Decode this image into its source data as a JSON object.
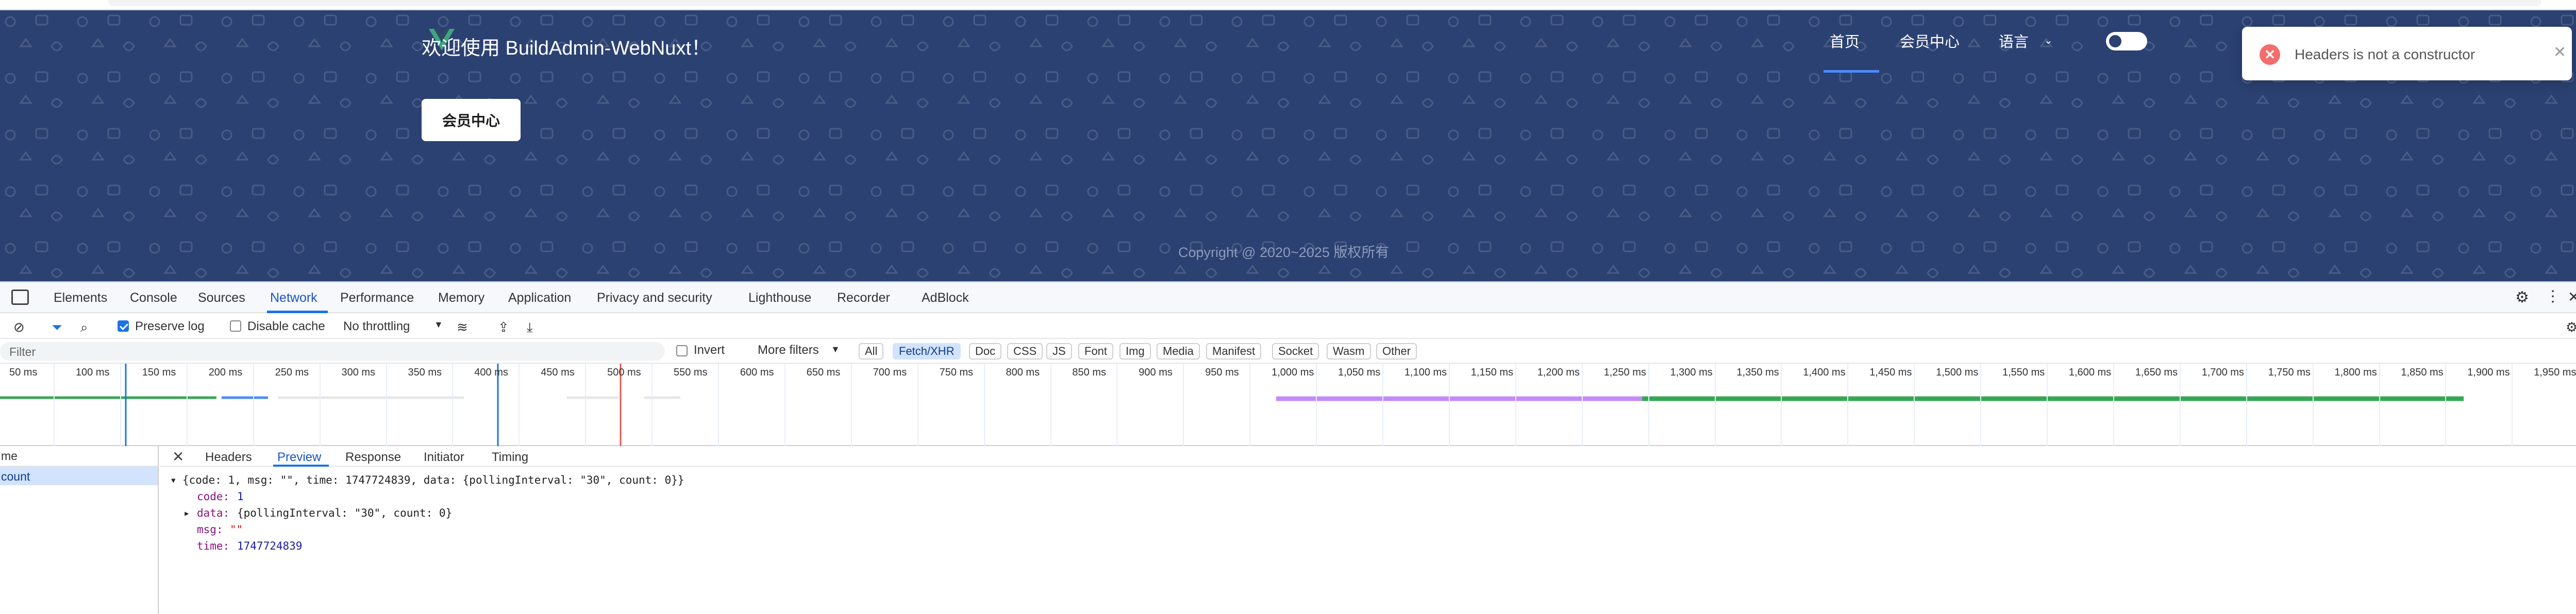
{
  "site": {
    "welcome": "欢迎使用 BuildAdmin-WebNuxt！",
    "member_button": "会员中心",
    "nav": {
      "home": "首页",
      "member": "会员中心",
      "language": "语言"
    },
    "copyright": "Copyright @ 2020~2025 版权所有",
    "colors": {
      "background": "#2b4172",
      "nav_active": "#4a8cff"
    }
  },
  "toast": {
    "message": "Headers is not a constructor",
    "type": "error",
    "icon": "error-circle-icon"
  },
  "devtools": {
    "tabs": [
      "Elements",
      "Console",
      "Sources",
      "Network",
      "Performance",
      "Memory",
      "Application",
      "Privacy and security",
      "Lighthouse",
      "Recorder",
      "AdBlock"
    ],
    "active_tab": "Network",
    "toolbar": {
      "preserve_log": "Preserve log",
      "disable_cache": "Disable cache",
      "throttling": "No throttling"
    },
    "filter": {
      "placeholder": "Filter",
      "invert": "Invert",
      "more_filters": "More filters",
      "types": [
        "All",
        "Fetch/XHR",
        "Doc",
        "CSS",
        "JS",
        "Font",
        "Img",
        "Media",
        "Manifest",
        "Socket",
        "Wasm",
        "Other"
      ],
      "active_type": "Fetch/XHR"
    },
    "timeline_ticks": [
      "50 ms",
      "100 ms",
      "150 ms",
      "200 ms",
      "250 ms",
      "300 ms",
      "350 ms",
      "400 ms",
      "450 ms",
      "500 ms",
      "550 ms",
      "600 ms",
      "650 ms",
      "700 ms",
      "750 ms",
      "800 ms",
      "850 ms",
      "900 ms",
      "950 ms",
      "1,000 ms",
      "1,050 ms",
      "1,100 ms",
      "1,150 ms",
      "1,200 ms",
      "1,250 ms",
      "1,300 ms",
      "1,350 ms",
      "1,400 ms",
      "1,450 ms",
      "1,500 ms",
      "1,550 ms",
      "1,600 ms",
      "1,650 ms",
      "1,700 ms",
      "1,750 ms",
      "1,800 ms",
      "1,850 ms",
      "1,900 ms",
      "1,950 ms"
    ],
    "request_list": {
      "header": "me",
      "row": "count"
    },
    "detail_tabs": [
      "Headers",
      "Preview",
      "Response",
      "Initiator",
      "Timing"
    ],
    "active_detail_tab": "Preview",
    "preview": {
      "summary": "{code: 1, msg: \"\", time: 1747724839, data: {pollingInterval: \"30\", count: 0}}",
      "code_key": "code:",
      "code_val": "1",
      "data_key": "data:",
      "data_val": "{pollingInterval: \"30\", count: 0}",
      "msg_key": "msg:",
      "msg_val": "\"\"",
      "time_key": "time:",
      "time_val": "1747724839"
    }
  }
}
